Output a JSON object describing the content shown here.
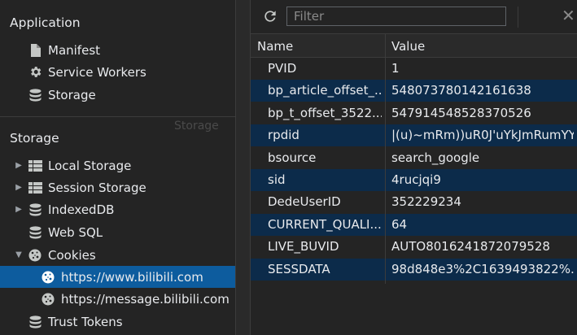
{
  "sidebar": {
    "application_title": "Application",
    "application_items": [
      {
        "label": "Manifest",
        "icon": "file-icon"
      },
      {
        "label": "Service Workers",
        "icon": "gear-icon"
      },
      {
        "label": "Storage",
        "icon": "database-icon"
      }
    ],
    "storage_title": "Storage",
    "storage_ghost_label": "Storage",
    "storage_items": [
      {
        "label": "Local Storage",
        "icon": "grid-icon",
        "expandable": true
      },
      {
        "label": "Session Storage",
        "icon": "grid-icon",
        "expandable": true
      },
      {
        "label": "IndexedDB",
        "icon": "database-icon",
        "expandable": true
      },
      {
        "label": "Web SQL",
        "icon": "database-icon"
      },
      {
        "label": "Cookies",
        "icon": "cookie-icon",
        "expanded": true
      },
      {
        "label": "https://www.bilibili.com",
        "icon": "cookie-icon",
        "selected": true
      },
      {
        "label": "https://message.bilibili.com",
        "icon": "cookie-icon"
      },
      {
        "label": "Trust Tokens",
        "icon": "database-icon"
      }
    ]
  },
  "toolbar": {
    "filter_placeholder": "Filter",
    "refresh_icon": "refresh-icon",
    "clear_icon": "close-icon",
    "clear_glyph": "✕"
  },
  "table": {
    "headers": {
      "name": "Name",
      "value": "Value"
    },
    "rows": [
      {
        "name": "PVID",
        "value": "1"
      },
      {
        "name": "bp_article_offset_...",
        "value": "548073780142161638"
      },
      {
        "name": "bp_t_offset_3522...",
        "value": "547914548528370526"
      },
      {
        "name": "rpdid",
        "value": "|(u)~mRm))uR0J'uYkJmRumYY"
      },
      {
        "name": "bsource",
        "value": "search_google"
      },
      {
        "name": "sid",
        "value": "4rucjqi9"
      },
      {
        "name": "DedeUserID",
        "value": "352229234"
      },
      {
        "name": "CURRENT_QUALI...",
        "value": "64"
      },
      {
        "name": "LIVE_BUVID",
        "value": "AUTO8016241872079528"
      },
      {
        "name": "SESSDATA",
        "value": "98d848e3%2C1639493822%..."
      }
    ]
  },
  "colors": {
    "background": "#242424",
    "selected": "#0d5c9e",
    "alt_row": "#0c2b4a",
    "text": "#e8eaed"
  }
}
